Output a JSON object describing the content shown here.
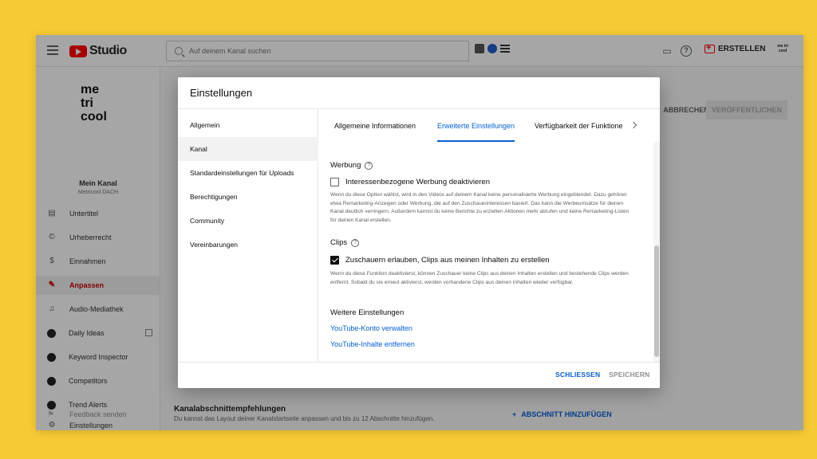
{
  "app": {
    "logo_text": "Studio",
    "search_placeholder": "Auf deinem Kanal suchen",
    "create_label": "ERSTELLEN",
    "avatar_text": "me tri cool"
  },
  "sidebar": {
    "channel_logo_lines": [
      "me",
      "tri",
      "cool"
    ],
    "channel_name": "Mein Kanal",
    "channel_handle": "Metricool DACH",
    "items": [
      {
        "label": "Untertitel",
        "icon": "subtitles-icon"
      },
      {
        "label": "Urheberrecht",
        "icon": "copyright-icon"
      },
      {
        "label": "Einnahmen",
        "icon": "dollar-icon"
      },
      {
        "label": "Anpassen",
        "icon": "magic-wand-icon"
      },
      {
        "label": "Audio-Mediathek",
        "icon": "music-library-icon"
      },
      {
        "label": "Daily Ideas",
        "icon": "extension-icon"
      },
      {
        "label": "Keyword Inspector",
        "icon": "extension-icon"
      },
      {
        "label": "Competitors",
        "icon": "extension-icon"
      },
      {
        "label": "Trend Alerts",
        "icon": "extension-icon"
      },
      {
        "label": "Einstellungen",
        "icon": "gear-icon"
      },
      {
        "label": "Feedback senden",
        "icon": "feedback-icon"
      }
    ]
  },
  "background": {
    "cancel_label": "ABBRECHEN",
    "publish_label": "VERÖFFENTLICHEN",
    "section_title": "Kanalabschnittempfehlungen",
    "section_sub": "Du kannst das Layout deiner Kanalstartseite anpassen und bis zu 12 Abschnitte hinzufügen.",
    "add_section_label": "ABSCHNITT HINZUFÜGEN"
  },
  "modal": {
    "title": "Einstellungen",
    "nav": [
      "Allgemein",
      "Kanal",
      "Standardeinstellungen für Uploads",
      "Berechtigungen",
      "Community",
      "Vereinbarungen"
    ],
    "active_nav": "Kanal",
    "tabs": [
      "Allgemeine Informationen",
      "Erweiterte Einstellungen",
      "Verfügbarkeit der Funktionen"
    ],
    "active_tab": "Erweiterte Einstellungen",
    "ad_section": {
      "title": "Werbung",
      "checkbox_label": "Interessenbezogene Werbung deaktivieren",
      "checked": false,
      "description": "Wenn du diese Option wählst, wird in den Videos auf deinem Kanal keine personalisierte Werbung eingeblendet. Dazu gehören etwa Remarketing-Anzeigen oder Werbung, die auf den Zuschauerinteressen basiert. Das kann die Werbeumsätze für deinen Kanal deutlich verringern. Außerdem kannst du keine Berichte zu erzielten Aktionen mehr abrufen und keine Remarketing-Listen für deinen Kanal erstellen."
    },
    "clips_section": {
      "title": "Clips",
      "checkbox_label": "Zuschauern erlauben, Clips aus meinen Inhalten zu erstellen",
      "checked": true,
      "description": "Wenn du diese Funktion deaktivierst, können Zuschauer keine Clips aus deinen Inhalten erstellen und bestehende Clips werden entfernt. Sobald du sie erneut aktivierst, werden vorhandene Clips aus deinen Inhalten wieder verfügbar."
    },
    "more_section": {
      "title": "Weitere Einstellungen",
      "links": [
        "YouTube-Konto verwalten",
        "YouTube-Inhalte entfernen"
      ]
    },
    "footer": {
      "close_label": "SCHLIESSEN",
      "save_label": "SPEICHERN"
    }
  },
  "colors": {
    "accent_blue": "#065fd4",
    "youtube_red": "#ff0000",
    "page_background": "#f7c934"
  }
}
